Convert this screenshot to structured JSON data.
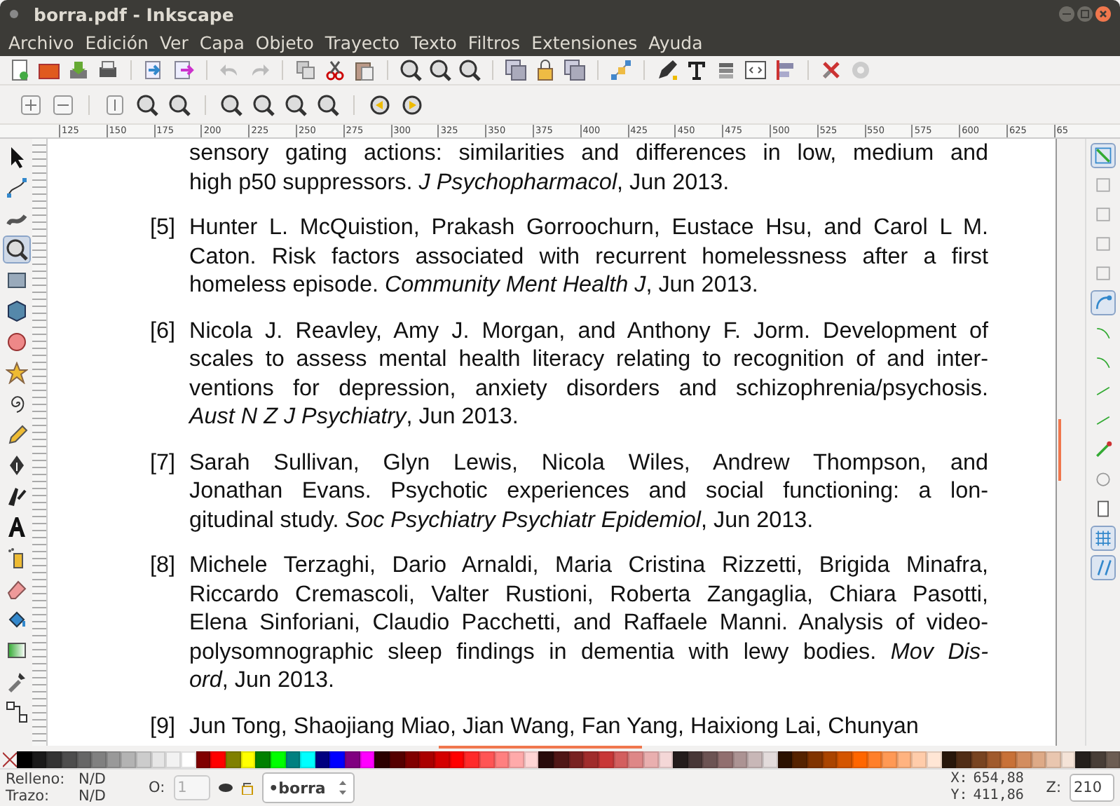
{
  "window": {
    "title": "borra.pdf - Inkscape"
  },
  "menu": [
    "Archivo",
    "Edición",
    "Ver",
    "Capa",
    "Objeto",
    "Trayecto",
    "Texto",
    "Filtros",
    "Extensiones",
    "Ayuda"
  ],
  "ruler": {
    "labels": [
      "125",
      "150",
      "175",
      "200",
      "225",
      "250",
      "275",
      "300",
      "325",
      "350",
      "375",
      "400",
      "425",
      "450",
      "475",
      "500",
      "525",
      "550",
      "575",
      "600",
      "625",
      "65"
    ]
  },
  "toolbox": {
    "tools": [
      {
        "selected": false
      },
      {
        "selected": false
      },
      {
        "selected": false
      },
      {
        "selected": true
      },
      {
        "selected": false
      },
      {
        "selected": false
      },
      {
        "selected": false
      },
      {
        "selected": false
      },
      {
        "selected": false
      },
      {
        "selected": false
      },
      {
        "selected": false
      },
      {
        "selected": false
      },
      {
        "selected": false
      },
      {
        "selected": false
      },
      {
        "selected": false
      },
      {
        "selected": false
      },
      {
        "selected": false
      },
      {
        "selected": false
      },
      {
        "selected": false
      }
    ]
  },
  "references": [
    {
      "lines": [
        "sensory gating actions: similarities and differences in low, medium and",
        "high p50 suppressors. *J Psychopharmacol*, Jun 2013."
      ]
    },
    {
      "number": "[5]",
      "lines": [
        "Hunter L. McQuistion, Prakash Gorroochurn, Eustace Hsu, and Carol L M.",
        "Caton. Risk factors associated with recurrent homelessness after a first",
        "homeless episode. *Community Ment Health J*, Jun 2013."
      ]
    },
    {
      "number": "[6]",
      "lines": [
        "Nicola J. Reavley, Amy J. Morgan, and Anthony F. Jorm. Development of",
        "scales to assess mental health literacy relating to recognition of and inter-",
        "ventions for depression, anxiety disorders and schizophrenia/psychosis.",
        "*Aust N Z J Psychiatry*, Jun 2013."
      ]
    },
    {
      "number": "[7]",
      "lines": [
        "Sarah Sullivan, Glyn Lewis, Nicola Wiles, Andrew Thompson, and",
        "Jonathan Evans. Psychotic experiences and social functioning: a lon-",
        "gitudinal study. *Soc Psychiatry Psychiatr Epidemiol*, Jun 2013."
      ]
    },
    {
      "number": "[8]",
      "lines": [
        "Michele Terzaghi, Dario Arnaldi, Maria Cristina Rizzetti, Brigida Minafra,",
        "Riccardo Cremascoli, Valter Rustioni, Roberta Zangaglia, Chiara Pasotti,",
        "Elena Sinforiani, Claudio Pacchetti, and Raffaele Manni. Analysis of video-",
        "polysomnographic sleep findings in dementia with lewy bodies. *Mov Dis-*",
        "*ord*, Jun 2013."
      ]
    },
    {
      "number": "[9]",
      "lines": [
        "Jun Tong, Shaojiang Miao, Jian Wang, Fan Yang, Haixiong Lai, Chunyan"
      ]
    }
  ],
  "snap_controls": [
    {
      "on": true
    },
    {
      "on": false
    },
    {
      "on": false
    },
    {
      "on": false
    },
    {
      "on": false
    },
    {
      "on": true
    },
    {
      "on": false
    },
    {
      "on": false
    },
    {
      "on": false
    },
    {
      "on": false
    },
    {
      "on": false
    },
    {
      "on": false
    },
    {
      "on": false
    },
    {
      "on": true
    },
    {
      "on": true
    }
  ],
  "palette": [
    {
      "color": "#000000"
    },
    {
      "color": "#1a1a1a"
    },
    {
      "color": "#333333"
    },
    {
      "color": "#4d4d4d"
    },
    {
      "color": "#666666"
    },
    {
      "color": "#808080"
    },
    {
      "color": "#999999"
    },
    {
      "color": "#b3b3b3"
    },
    {
      "color": "#cccccc"
    },
    {
      "color": "#e6e6e6"
    },
    {
      "color": "#f2f2f2"
    },
    {
      "color": "#ffffff"
    },
    {
      "color": "#800000"
    },
    {
      "color": "#ff0000"
    },
    {
      "color": "#808000"
    },
    {
      "color": "#ffff00"
    },
    {
      "color": "#008000"
    },
    {
      "color": "#00ff00"
    },
    {
      "color": "#008080"
    },
    {
      "color": "#00ffff"
    },
    {
      "color": "#000080"
    },
    {
      "color": "#0000ff"
    },
    {
      "color": "#800080"
    },
    {
      "color": "#ff00ff"
    },
    {
      "color": "#2b0000"
    },
    {
      "color": "#550000"
    },
    {
      "color": "#800000"
    },
    {
      "color": "#aa0000"
    },
    {
      "color": "#d40000"
    },
    {
      "color": "#ff0000"
    },
    {
      "color": "#ff2a2a"
    },
    {
      "color": "#ff5555"
    },
    {
      "color": "#ff8080"
    },
    {
      "color": "#ffaaaa"
    },
    {
      "color": "#ffd5d5"
    },
    {
      "color": "#280b0b"
    },
    {
      "color": "#501616"
    },
    {
      "color": "#782121"
    },
    {
      "color": "#a02c2c"
    },
    {
      "color": "#c83737"
    },
    {
      "color": "#d35f5f"
    },
    {
      "color": "#de8787"
    },
    {
      "color": "#e9afaf"
    },
    {
      "color": "#f4d7d7"
    },
    {
      "color": "#241c1c"
    },
    {
      "color": "#483737"
    },
    {
      "color": "#6c5353"
    },
    {
      "color": "#916f6f"
    },
    {
      "color": "#ac9393"
    },
    {
      "color": "#c8b7b7"
    },
    {
      "color": "#e3dbdb"
    },
    {
      "color": "#2b1100"
    },
    {
      "color": "#552200"
    },
    {
      "color": "#803300"
    },
    {
      "color": "#aa4400"
    },
    {
      "color": "#d45500"
    },
    {
      "color": "#ff6600"
    },
    {
      "color": "#ff7f2a"
    },
    {
      "color": "#ff9955"
    },
    {
      "color": "#ffb380"
    },
    {
      "color": "#ffccaa"
    },
    {
      "color": "#ffe6d5"
    },
    {
      "color": "#28170b"
    },
    {
      "color": "#502d16"
    },
    {
      "color": "#784421"
    },
    {
      "color": "#a05a2c"
    },
    {
      "color": "#c87137"
    },
    {
      "color": "#d38d5f"
    },
    {
      "color": "#deaa87"
    },
    {
      "color": "#e9c6af"
    },
    {
      "color": "#f4e3d7"
    },
    {
      "color": "#241f1c"
    },
    {
      "color": "#483e37"
    },
    {
      "color": "#6c5d53"
    }
  ],
  "status": {
    "fill_label": "Relleno:",
    "fill_value": "N/D",
    "stroke_label": "Trazo:",
    "stroke_value": "N/D",
    "opacity_label": "O:",
    "opacity_value": "1",
    "layer": "•borra",
    "x_label": "X:",
    "x_value": "654,88",
    "y_label": "Y:",
    "y_value": "411,86",
    "zoom_label": "Z:",
    "zoom_value": "210"
  }
}
